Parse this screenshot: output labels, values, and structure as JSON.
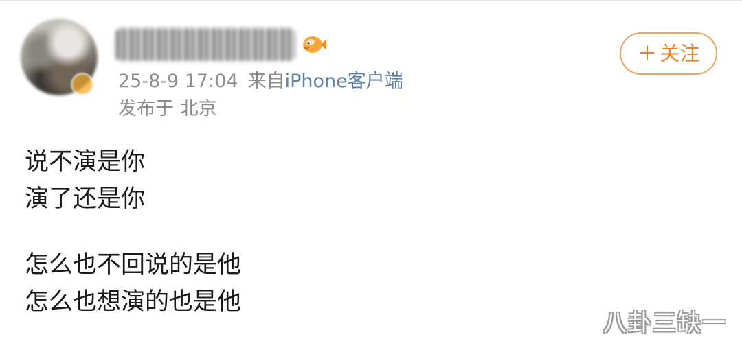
{
  "post": {
    "header": {
      "timestamp": "25-8-9 17:04",
      "source_prefix": "来自",
      "source_client": "iPhone客户端",
      "location": "发布于 北京"
    },
    "follow_button": {
      "plus": "＋",
      "label": "关注"
    },
    "content_lines": [
      "说不演是你",
      "演了还是你",
      "怎么也不回说的是他",
      "怎么也想演的也是他"
    ]
  },
  "watermark": "八卦三缺一",
  "colors": {
    "meta_text": "#8d8d8d",
    "client_link": "#5b7da6",
    "follow_accent": "#e8822b",
    "body_text": "#1a1a1a"
  },
  "icons": {
    "user_badge": "fish-icon",
    "avatar_badge": "verified-badge-icon"
  }
}
